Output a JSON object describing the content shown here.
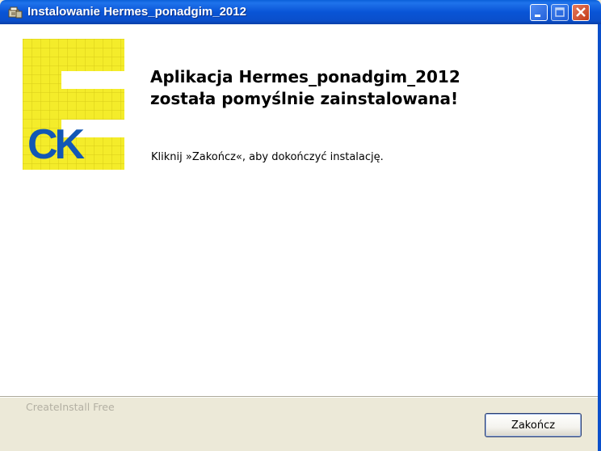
{
  "window": {
    "title": "Instalowanie Hermes_ponadgim_2012",
    "title_icon": "installer-icon",
    "controls": [
      "minimize-icon",
      "maximize-icon",
      "close-icon"
    ]
  },
  "logo": {
    "text": "CK",
    "colors": {
      "grid_yellow": "#f4ec2a",
      "letters_blue": "#1257b5"
    }
  },
  "main": {
    "heading_line1": "Aplikacja Hermes_ponadgim_2012",
    "heading_line2": "została pomyślnie zainstalowana!",
    "message": "Kliknij »Zakończ«, aby dokończyć instalację."
  },
  "footer": {
    "brand": "CreateInstall Free",
    "finish_label": "Zakończ"
  },
  "colors": {
    "titlebar": "#0a54d6",
    "dialog_bg": "#ece9d8",
    "content_bg": "#ffffff",
    "close_button": "#c23a17"
  }
}
